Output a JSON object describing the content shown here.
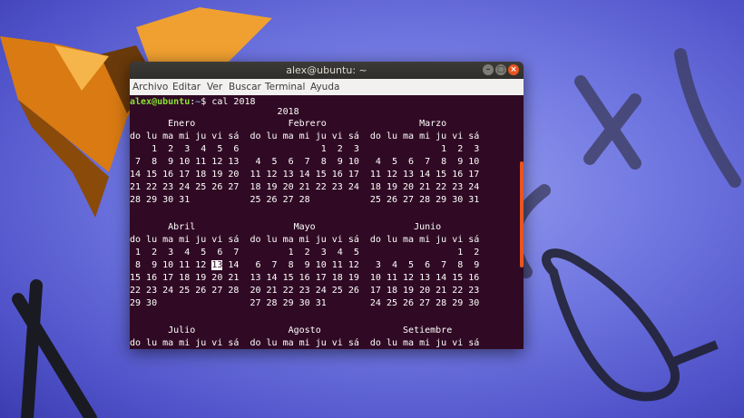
{
  "window": {
    "title": "alex@ubuntu: ~"
  },
  "menu": [
    "Archivo",
    "Editar",
    "Ver",
    "Buscar",
    "Terminal",
    "Ayuda"
  ],
  "prompt": {
    "user_host": "alex@ubuntu",
    "sep": ":",
    "path": "~",
    "symbol": "$ ",
    "command": "cal 2018"
  },
  "calendar": {
    "year_line": "                           2018",
    "lines": [
      "       Enero                 Febrero                 Marzo",
      "do lu ma mi ju vi sá  do lu ma mi ju vi sá  do lu ma mi ju vi sá",
      "    1  2  3  4  5  6               1  2  3               1  2  3",
      " 7  8  9 10 11 12 13   4  5  6  7  8  9 10   4  5  6  7  8  9 10",
      "14 15 16 17 18 19 20  11 12 13 14 15 16 17  11 12 13 14 15 16 17",
      "21 22 23 24 25 26 27  18 19 20 21 22 23 24  18 19 20 21 22 23 24",
      "28 29 30 31           25 26 27 28           25 26 27 28 29 30 31",
      "",
      "",
      "       Abril                  Mayo                  Junio",
      "do lu ma mi ju vi sá  do lu ma mi ju vi sá  do lu ma mi ju vi sá",
      " 1  2  3  4  5  6  7         1  2  3  4  5                  1  2",
      " 8  9 10 11 12 ",
      "15 16 17 18 19 20 21  13 14 15 16 17 18 19  10 11 12 13 14 15 16",
      "22 23 24 25 26 27 28  20 21 22 23 24 25 26  17 18 19 20 21 22 23",
      "29 30                 27 28 29 30 31        24 25 26 27 28 29 30",
      "",
      "",
      "       Julio                 Agosto               Setiembre",
      "do lu ma mi ju vi sá  do lu ma mi ju vi sá  do lu ma mi ju vi sá"
    ],
    "today": "13",
    "today_rest": " 14   6  7  8  9 10 11 12   3  4  5  6  7  8  9"
  }
}
